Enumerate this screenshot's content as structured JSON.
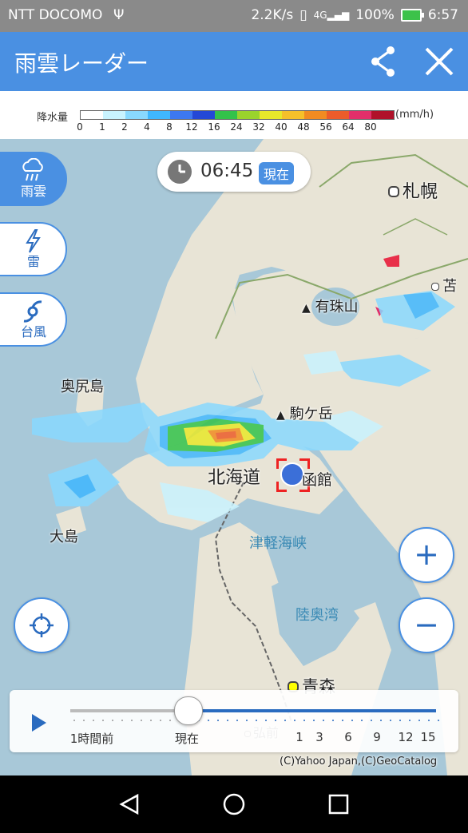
{
  "status_bar": {
    "carrier": "NTT DOCOMO",
    "usb_icon": "usb-icon",
    "net_speed": "2.2K/s",
    "network": "4G",
    "battery": "100%",
    "time": "6:57"
  },
  "app_bar": {
    "title": "雨雲レーダー",
    "share_icon": "share-icon",
    "close_icon": "close-icon",
    "color": "#4a90e2"
  },
  "legend": {
    "label": "降水量",
    "unit": "(mm/h)",
    "ticks": [
      "0",
      "1",
      "2",
      "4",
      "8",
      "12",
      "16",
      "24",
      "32",
      "40",
      "48",
      "56",
      "64",
      "80"
    ],
    "colors": [
      "#ffffff",
      "#c9f3ff",
      "#89d9ff",
      "#3fb7ff",
      "#3d78f0",
      "#2448d6",
      "#33c24a",
      "#9ad32c",
      "#e8e82a",
      "#f6c02a",
      "#f18b22",
      "#ec5c2a",
      "#e22f6a",
      "#b0122a"
    ]
  },
  "layers": {
    "rain": "雨雲",
    "thunder": "雷",
    "typhoon": "台風"
  },
  "time_pill": {
    "clock_icon": "clock-icon",
    "time": "06:45",
    "badge": "現在"
  },
  "map": {
    "labels": {
      "sapporo": "札幌",
      "toma": "苫",
      "usu": "有珠山",
      "okushiri": "奥尻島",
      "komagatake": "駒ケ岳",
      "hokkaido": "北海道",
      "hakodate": "函館",
      "oshima": "大島",
      "tsugaru": "津軽海峡",
      "mutsu": "陸奥湾",
      "aomori": "青森",
      "hirosaki": "弘前"
    },
    "location_icon": "current-location-marker-icon"
  },
  "zoom": {
    "in": "+",
    "out": "−"
  },
  "locate_icon": "crosshair-icon",
  "slider": {
    "play_icon": "play-icon",
    "labels": [
      "1時間前",
      "現在",
      "1",
      "3",
      "6",
      "9",
      "12",
      "15"
    ],
    "position_fraction": 0.32
  },
  "copyright": "(C)Yahoo Japan,(C)GeoCatalog",
  "nav": {
    "back_icon": "back-icon",
    "home_icon": "home-icon",
    "recents_icon": "recents-icon"
  }
}
